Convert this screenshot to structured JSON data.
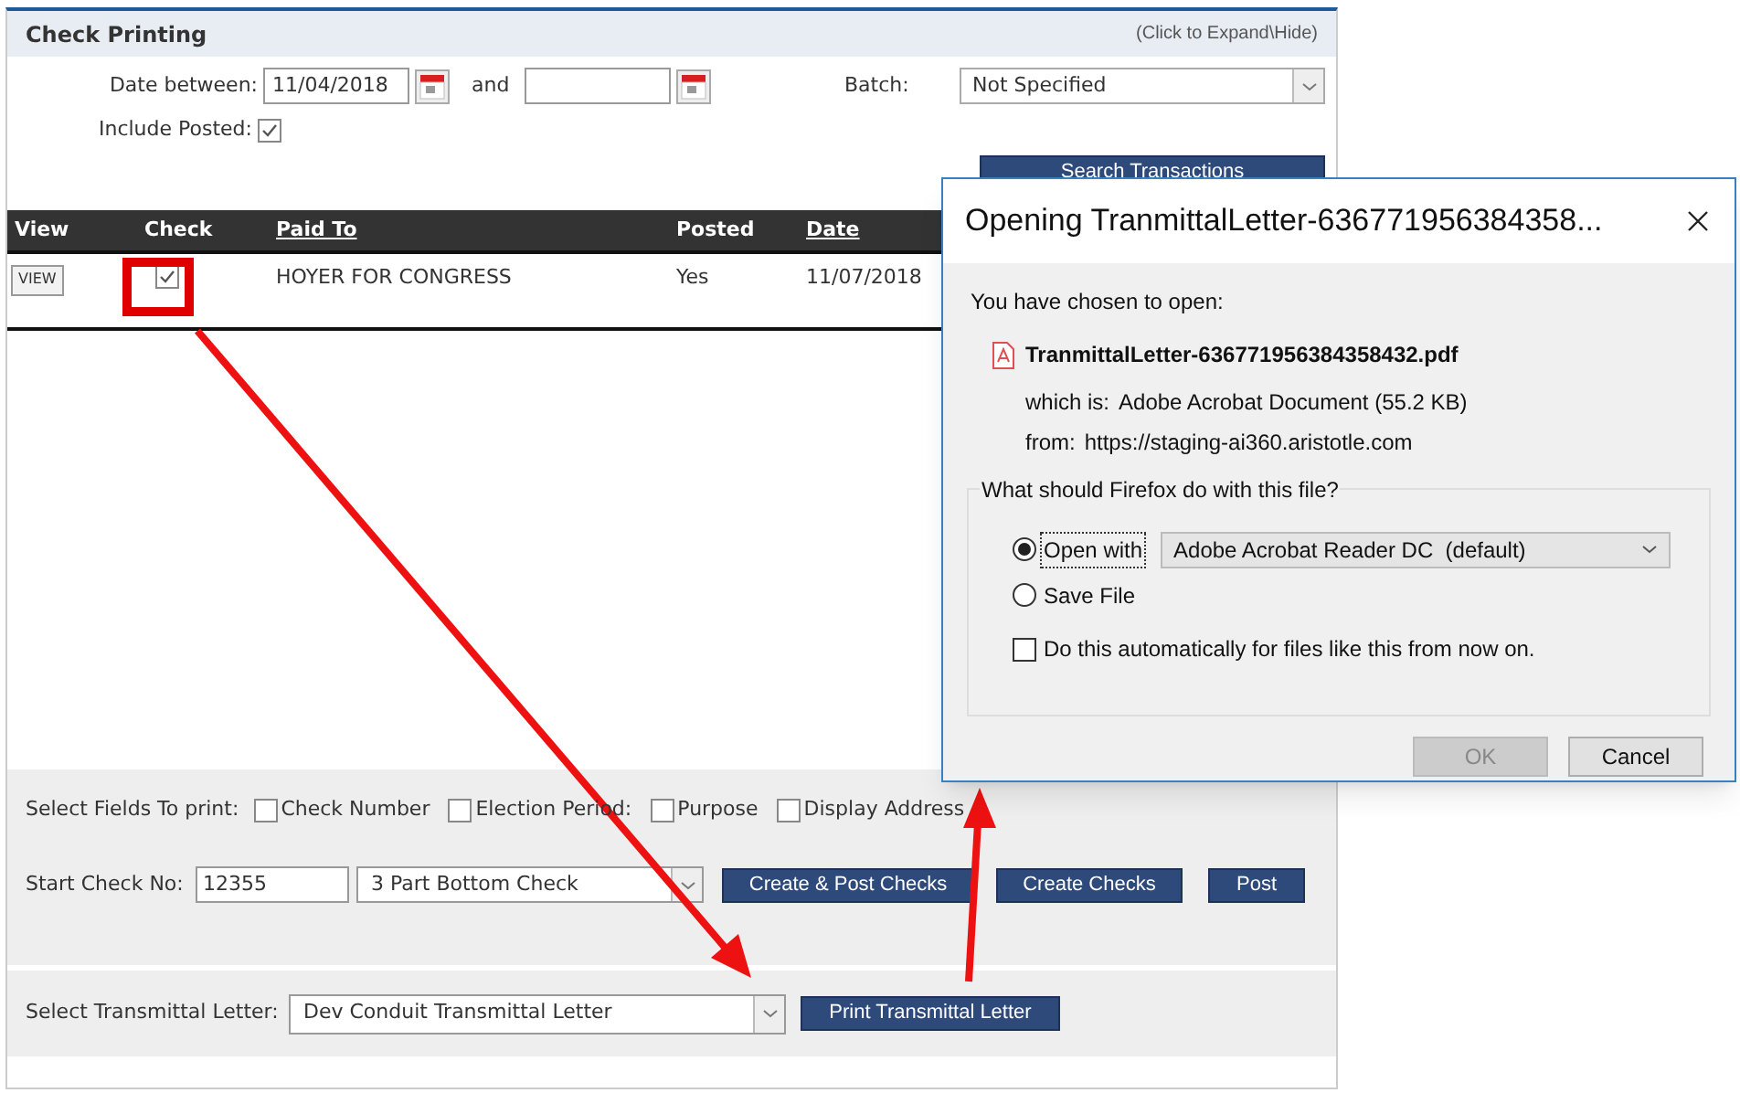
{
  "panel": {
    "title": "Check Printing",
    "expand_hint": "(Click to Expand\\Hide)"
  },
  "filters": {
    "date_label": "Date between:",
    "date_from": "11/04/2018",
    "and_label": "and",
    "batch_label": "Batch:",
    "batch_value": "Not Specified",
    "include_posted": {
      "label": "Include Posted:",
      "checked": true
    },
    "search_button": "Search Transactions"
  },
  "table": {
    "columns": [
      {
        "label": "View",
        "sortable": false
      },
      {
        "label": "Check",
        "sortable": false
      },
      {
        "label": "Paid To",
        "sortable": true
      },
      {
        "label": "Posted",
        "sortable": false
      },
      {
        "label": "Date",
        "sortable": true
      }
    ],
    "rows": [
      {
        "view_button": "VIEW",
        "checked": true,
        "paid_to": "HOYER FOR CONGRESS",
        "posted": "Yes",
        "date": "11/07/2018"
      }
    ]
  },
  "print_fields": {
    "label": "Select Fields To print:",
    "options": [
      {
        "label": "Check Number",
        "checked": false
      },
      {
        "label": "Election Period:",
        "checked": false
      },
      {
        "label": "Purpose",
        "checked": false
      },
      {
        "label": "Display Address",
        "checked": false
      }
    ]
  },
  "start_check": {
    "label": "Start Check No:",
    "value": "12355",
    "check_type": "3 Part Bottom Check",
    "buttons": [
      "Create & Post Checks",
      "Create Checks",
      "Post"
    ]
  },
  "transmittal": {
    "label": "Select Transmittal Letter:",
    "value": "Dev Conduit Transmittal Letter",
    "button": "Print Transmittal Letter"
  },
  "dialog": {
    "title": "Opening TranmittalLetter-636771956384358...",
    "intro": "You have chosen to open:",
    "file_name": "TranmittalLetter-636771956384358432.pdf",
    "which_is_label": "which is:",
    "which_is": "Adobe Acrobat Document (55.2 KB)",
    "from_label": "from:",
    "from": "https://staging-ai360.aristotle.com",
    "group_label": "What should Firefox do with this file?",
    "choices": [
      {
        "label": "Open with",
        "selected": true
      },
      {
        "label": "Save File",
        "selected": false
      }
    ],
    "app": "Adobe Acrobat Reader DC  (default)",
    "auto": {
      "label": "Do this automatically for files like this from now on.",
      "checked": false
    },
    "buttons": [
      {
        "label": "OK",
        "disabled": true
      },
      {
        "label": "Cancel",
        "disabled": false
      }
    ]
  }
}
